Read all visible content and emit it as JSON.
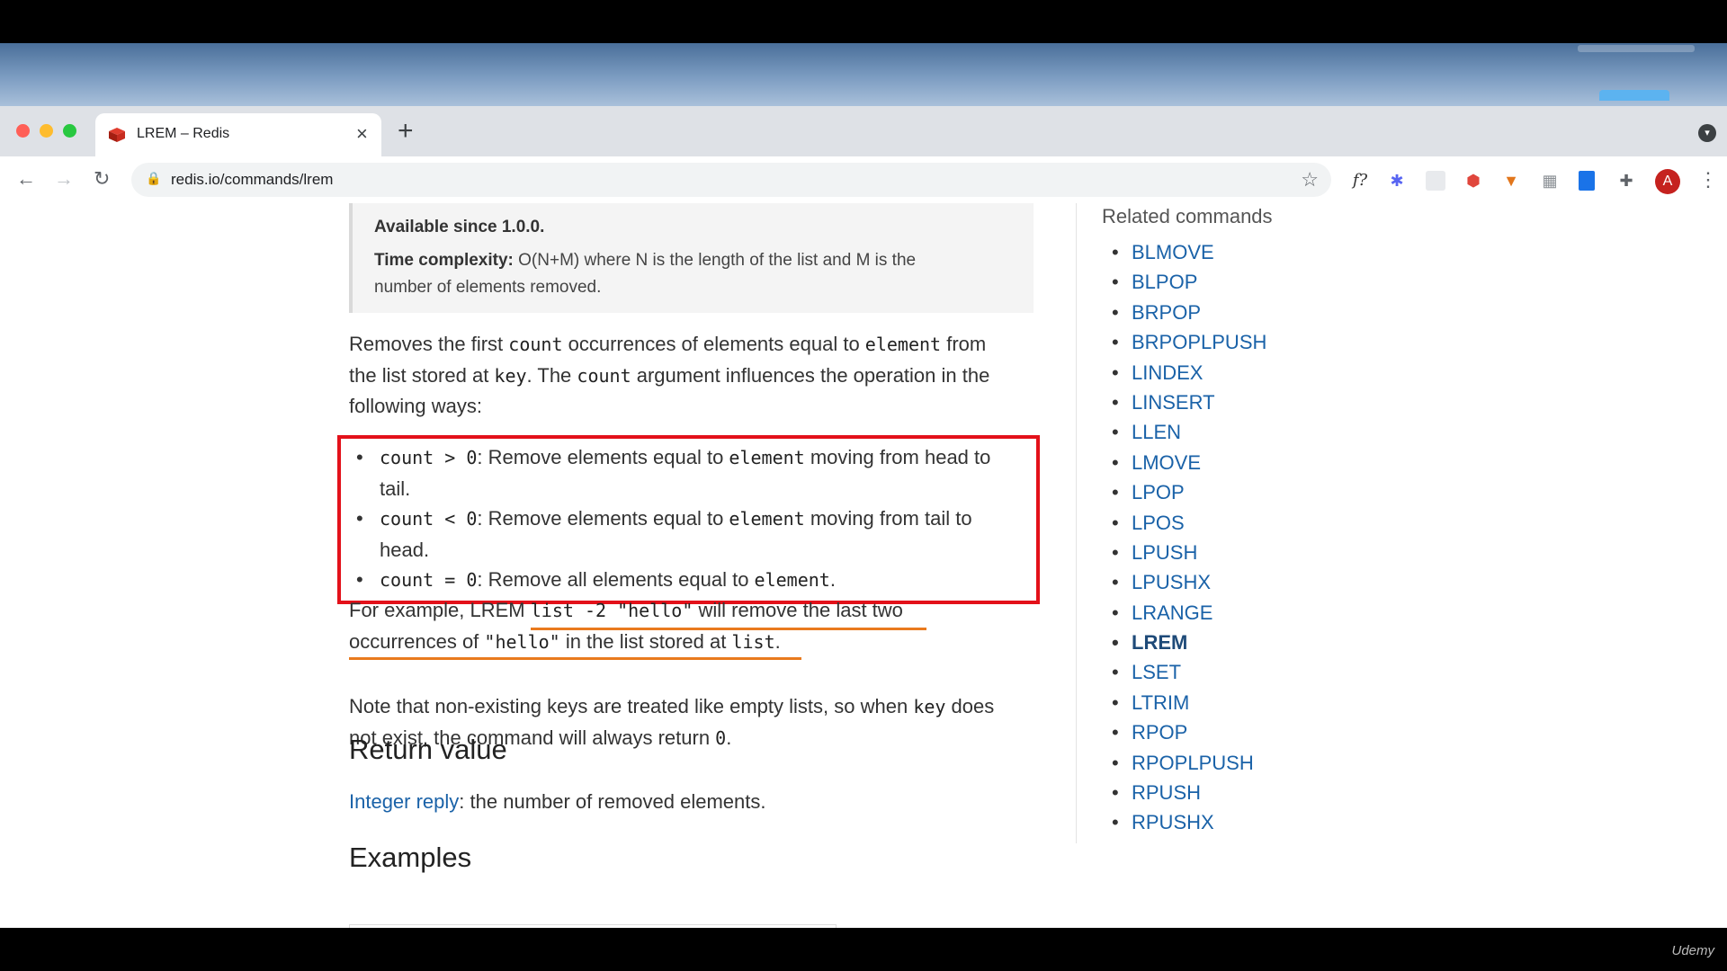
{
  "browser": {
    "tab_title": "LREM – Redis",
    "url": "redis.io/commands/lrem",
    "avatar_letter": "A"
  },
  "doc": {
    "available_since": "Available since 1.0.0.",
    "time_complexity_label": "Time complexity:",
    "time_complexity_text": " O(N+M) where N is the length of the list and M is the",
    "time_complexity_text2": "number of elements removed.",
    "intro": {
      "t1": "Removes the first ",
      "c1": "count",
      "t2": " occurrences of elements equal to ",
      "c2": "element",
      "t3": " from",
      "t4": "the list stored at ",
      "c3": "key",
      "t5": ". The ",
      "c4": "count",
      "t6": " argument influences the operation in the",
      "t7": "following ways:"
    },
    "bullets": [
      {
        "code": "count > 0",
        "t1": ": Remove elements equal to ",
        "code2": "element",
        "t2": " moving from head to",
        "t3": "tail."
      },
      {
        "code": "count < 0",
        "t1": ": Remove elements equal to ",
        "code2": "element",
        "t2": " moving from tail to",
        "t3": "head."
      },
      {
        "code": "count = 0",
        "t1": ": Remove all elements equal to ",
        "code2": "element",
        "t2": "."
      }
    ],
    "example": {
      "t1": "For example, ",
      "t1b": "LREM ",
      "c1": "list -2 \"hello\"",
      "t2": " will remove the last two",
      "t3": "occurrences of ",
      "c2": "\"hello\"",
      "t4": " in the list stored at ",
      "c3": "list",
      "t5": "."
    },
    "note": {
      "t1": "Note that non-existing keys are treated like empty lists, so when ",
      "c1": "key",
      "t2": " does",
      "t3": "not exist, the command will always return ",
      "c2": "0",
      "t4": "."
    },
    "return_heading": "Return value",
    "return_link": "Integer reply",
    "return_text": ": the number of removed elements.",
    "examples_heading": "Examples"
  },
  "related": {
    "title": "Related commands",
    "current": "LREM",
    "items": [
      "BLMOVE",
      "BLPOP",
      "BRPOP",
      "BRPOPLPUSH",
      "LINDEX",
      "LINSERT",
      "LLEN",
      "LMOVE",
      "LPOP",
      "LPOS",
      "LPUSH",
      "LPUSHX",
      "LRANGE",
      "LREM",
      "LSET",
      "LTRIM",
      "RPOP",
      "RPOPLPUSH",
      "RPUSH",
      "RPUSHX"
    ]
  },
  "watermark": "Udemy"
}
